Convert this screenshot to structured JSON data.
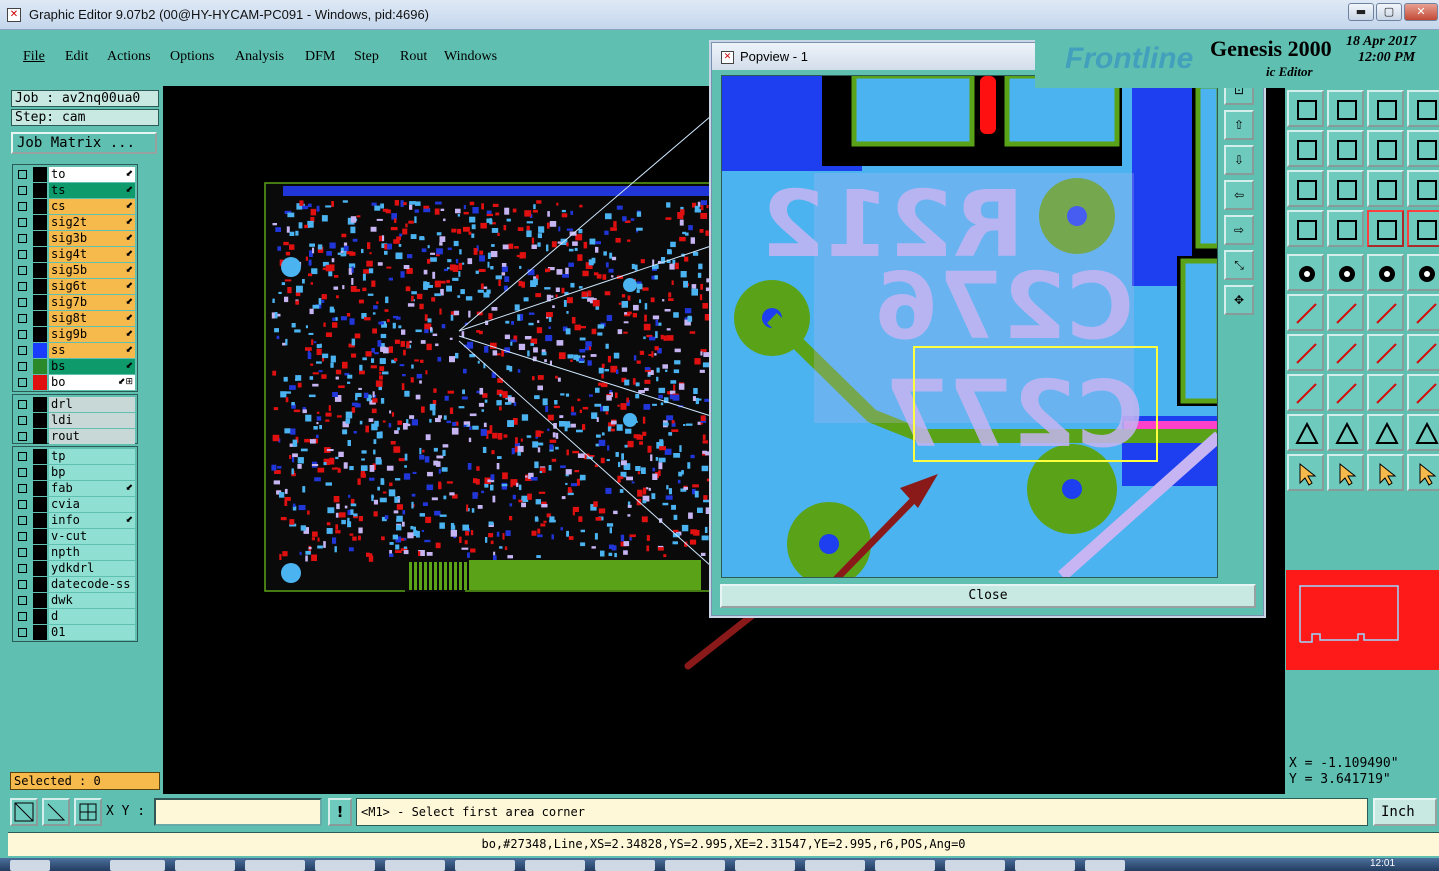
{
  "window": {
    "title": "Graphic Editor 9.07b2 (00@HY-HYCAM-PC091 - Windows, pid:4696)",
    "min": "▬",
    "max": "▢",
    "close": "✕"
  },
  "menu": [
    "File",
    "Edit",
    "Actions",
    "Options",
    "Analysis",
    "DFM",
    "Step",
    "Rout",
    "Windows"
  ],
  "job": {
    "job": "Job : av2nq00ua0",
    "step": "Step: cam",
    "matrix": "Job Matrix ..."
  },
  "layers_group1": [
    {
      "name": "to",
      "bg": "#ffffff",
      "sw": "#000000",
      "flag": "⬋"
    },
    {
      "name": "ts",
      "bg": "#0e9a6a",
      "sw": "#000000",
      "flag": "⬋"
    },
    {
      "name": "cs",
      "bg": "#f6b94c",
      "sw": "#000000",
      "flag": "⬋"
    },
    {
      "name": "sig2t",
      "bg": "#f6b94c",
      "sw": "#000000",
      "flag": "⬋"
    },
    {
      "name": "sig3b",
      "bg": "#f6b94c",
      "sw": "#000000",
      "flag": "⬋"
    },
    {
      "name": "sig4t",
      "bg": "#f6b94c",
      "sw": "#000000",
      "flag": "⬋"
    },
    {
      "name": "sig5b",
      "bg": "#f6b94c",
      "sw": "#000000",
      "flag": "⬋"
    },
    {
      "name": "sig6t",
      "bg": "#f6b94c",
      "sw": "#000000",
      "flag": "⬋"
    },
    {
      "name": "sig7b",
      "bg": "#f6b94c",
      "sw": "#000000",
      "flag": "⬋"
    },
    {
      "name": "sig8t",
      "bg": "#f6b94c",
      "sw": "#000000",
      "flag": "⬋"
    },
    {
      "name": "sig9b",
      "bg": "#f6b94c",
      "sw": "#000000",
      "flag": "⬋"
    },
    {
      "name": "ss",
      "bg": "#f6b94c",
      "sw": "#1a3cff",
      "flag": "⬋"
    },
    {
      "name": "bs",
      "bg": "#0e9a6a",
      "sw": "#2a8a2a",
      "flag": "⬋"
    },
    {
      "name": "bo",
      "bg": "#ffffff",
      "sw": "#e01010",
      "flag": "⬋⊞"
    }
  ],
  "layers_group2": [
    {
      "name": "drl",
      "bg": "#c8d8d6",
      "sw": "#000000",
      "flag": ""
    },
    {
      "name": "ldi",
      "bg": "#c8d8d6",
      "sw": "#000000",
      "flag": ""
    },
    {
      "name": "rout",
      "bg": "#c8d8d6",
      "sw": "#000000",
      "flag": ""
    }
  ],
  "layers_group3": [
    {
      "name": "tp",
      "bg": "#8fe0d2",
      "sw": "#000000",
      "flag": ""
    },
    {
      "name": "bp",
      "bg": "#8fe0d2",
      "sw": "#000000",
      "flag": ""
    },
    {
      "name": "fab",
      "bg": "#8fe0d2",
      "sw": "#000000",
      "flag": "⬋"
    },
    {
      "name": "cvia",
      "bg": "#8fe0d2",
      "sw": "#000000",
      "flag": ""
    },
    {
      "name": "info",
      "bg": "#8fe0d2",
      "sw": "#000000",
      "flag": "⬋"
    },
    {
      "name": "v-cut",
      "bg": "#8fe0d2",
      "sw": "#000000",
      "flag": ""
    },
    {
      "name": "npth",
      "bg": "#8fe0d2",
      "sw": "#000000",
      "flag": ""
    },
    {
      "name": "ydkdrl",
      "bg": "#8fe0d2",
      "sw": "#000000",
      "flag": ""
    },
    {
      "name": "datecode-ss",
      "bg": "#8fe0d2",
      "sw": "#000000",
      "flag": ""
    },
    {
      "name": "dwk",
      "bg": "#8fe0d2",
      "sw": "#000000",
      "flag": ""
    },
    {
      "name": "d",
      "bg": "#8fe0d2",
      "sw": "#000000",
      "flag": ""
    },
    {
      "name": "01",
      "bg": "#8fe0d2",
      "sw": "#000000",
      "flag": ""
    }
  ],
  "selected": "Selected : 0",
  "popview": {
    "title": "Popview - 1",
    "close_x": "✕",
    "close": "Close",
    "labels": [
      "R212",
      "C276",
      "C277"
    ]
  },
  "brand": {
    "genesis": "Genesis 2000",
    "date": "18 Apr 2017",
    "time": "12:00 PM",
    "sub": "ic Editor",
    "frontline": "Frontline"
  },
  "coords": {
    "x": "X = -1.109490\"",
    "y": "Y = 3.641719\""
  },
  "bottom": {
    "xy_label": "X Y :",
    "xy_value": "",
    "warn": "!",
    "prompt": "<M1> - Select first area corner",
    "unit": "Inch"
  },
  "status": "bo,#27348,Line,XS=2.34828,YS=2.995,XE=2.31547,YE=2.995,r6,POS,Ang=0",
  "colors": {
    "teal": "#5fbfb0",
    "copper": "#4ab3f0",
    "pad": "#5aa318",
    "silk": "#c6b5f2",
    "accent": "#ff1a1a"
  },
  "taskbar": {
    "clock": "12:01"
  }
}
